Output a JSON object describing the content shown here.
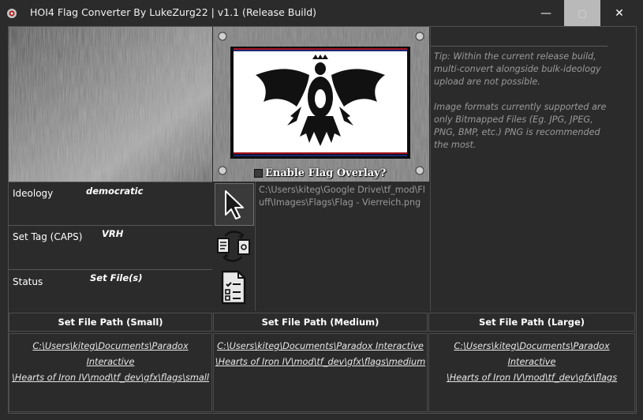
{
  "window": {
    "title": "HOI4 Flag Converter By LukeZurg22 | v1.1 (Release Build)",
    "minimize": "—",
    "maximize": "▢",
    "close": "✕"
  },
  "preview": {
    "overlay_label": "Enable Flag Overlay?",
    "flag_colors": {
      "red": "#a4121c",
      "blue": "#1a2a78"
    }
  },
  "tip": {
    "line1": "Tip: Within the current release build, multi-convert alongside bulk-ideology upload are not possible.",
    "line2": "Image formats currently supported are only Bitmapped Files (Eg. JPG, JPEG, PNG, BMP, etc.) PNG is recommended the most."
  },
  "fields": {
    "ideology_label": "Ideology",
    "ideology_value": "democratic",
    "tag_label": "Set Tag (CAPS)",
    "tag_value": "VRH",
    "status_label": "Status",
    "status_value": "Set File(s)"
  },
  "tools": {
    "cursor": "cursor-icon",
    "convert": "convert-files-icon",
    "list": "checklist-icon"
  },
  "source_path": "C:\\Users\\kiteg\\Google Drive\\tf_mod\\Fluff\\Images\\Flags\\Flag - Vierreich.png",
  "sections": [
    {
      "label": "Set File Path (Small)",
      "path": "C:\\Users\\kiteg\\Documents\\Paradox Interactive\n\\Hearts of Iron IV\\mod\\tf_dev\\gfx\\flags\\small"
    },
    {
      "label": "Set File Path (Medium)",
      "path": "C:\\Users\\kiteg\\Documents\\Paradox Interactive\n\\Hearts of Iron IV\\mod\\tf_dev\\gfx\\flags\\medium"
    },
    {
      "label": "Set File Path (Large)",
      "path": "C:\\Users\\kiteg\\Documents\\Paradox Interactive\n\\Hearts of Iron IV\\mod\\tf_dev\\gfx\\flags"
    }
  ]
}
